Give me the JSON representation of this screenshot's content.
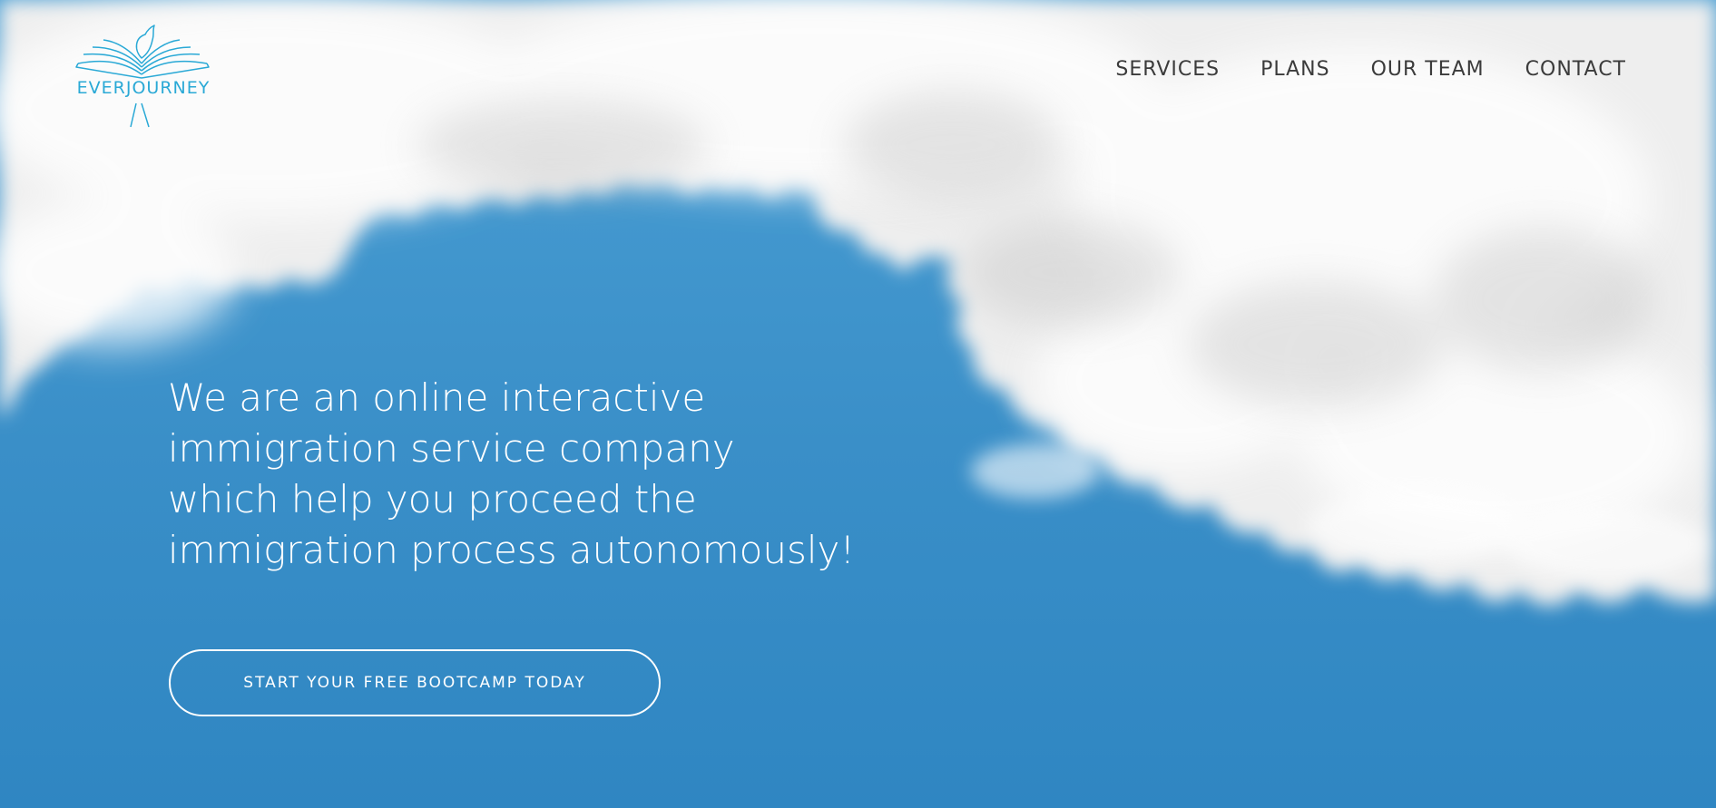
{
  "brand": {
    "name": "EVERJOURNEY",
    "accent_color": "#2aa9d6"
  },
  "nav": {
    "items": [
      {
        "label": "SERVICES"
      },
      {
        "label": "PLANS"
      },
      {
        "label": "OUR TEAM"
      },
      {
        "label": "CONTACT"
      }
    ],
    "text_color": "#3b3b3b"
  },
  "hero": {
    "headline": "We are an online interactive immigration service company which help you proceed the immigration process autonomously!",
    "cta_label": "START YOUR FREE BOOTCAMP TODAY",
    "sky_color": "#3a8fc8",
    "text_color": "#ffffff"
  }
}
